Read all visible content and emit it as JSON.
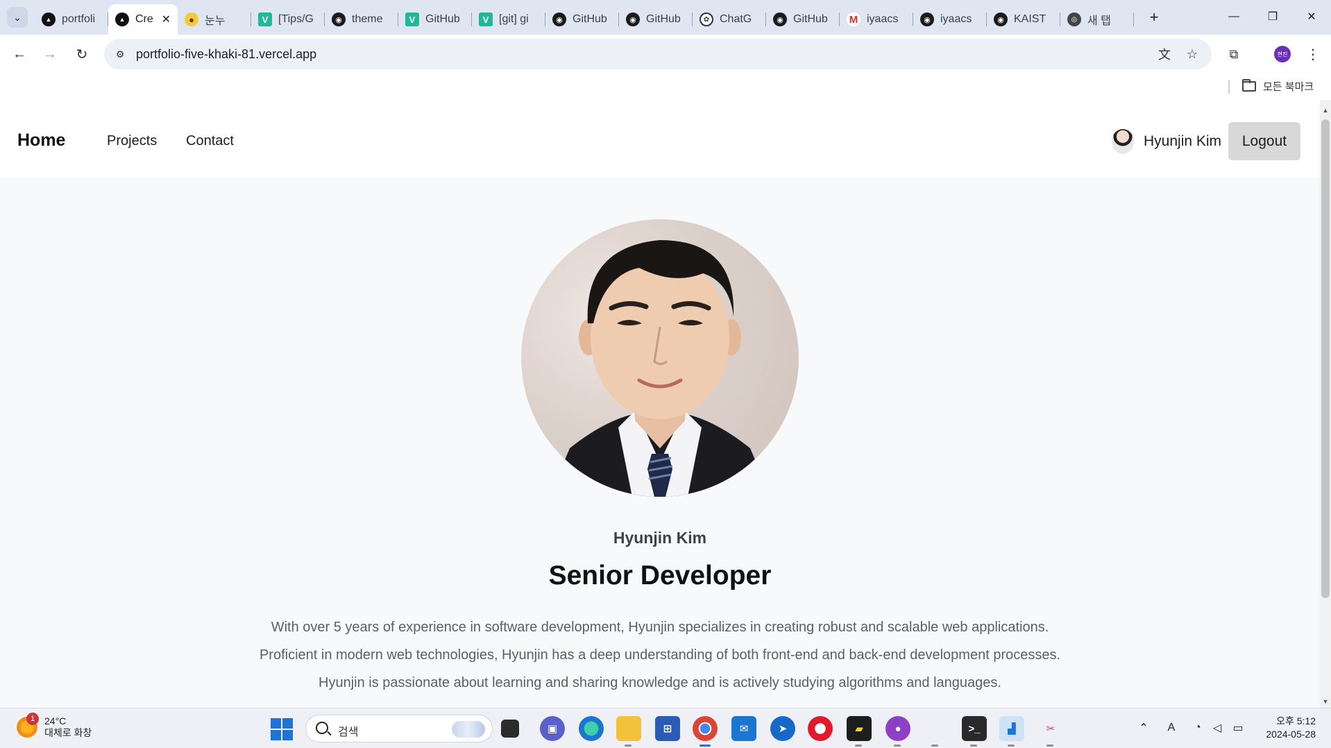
{
  "browser": {
    "tabs": [
      {
        "label": "portfoli",
        "icon": "vercel-icon",
        "active": false
      },
      {
        "label": "Cre",
        "icon": "vercel-icon",
        "active": true
      },
      {
        "label": "눈누",
        "icon": "duck-icon",
        "active": false
      },
      {
        "label": "[Tips/G",
        "icon": "velog-icon",
        "active": false
      },
      {
        "label": "theme",
        "icon": "github-icon",
        "active": false
      },
      {
        "label": "GitHub",
        "icon": "velog-icon",
        "active": false
      },
      {
        "label": "[git] gi",
        "icon": "velog-icon",
        "active": false
      },
      {
        "label": "GitHub",
        "icon": "github-icon",
        "active": false
      },
      {
        "label": "GitHub",
        "icon": "github-icon",
        "active": false
      },
      {
        "label": "ChatG",
        "icon": "chatgpt-icon",
        "active": false
      },
      {
        "label": "GitHub",
        "icon": "github-icon",
        "active": false
      },
      {
        "label": "iyaacs",
        "icon": "gmail-icon",
        "active": false
      },
      {
        "label": "iyaacs",
        "icon": "github-icon",
        "active": false
      },
      {
        "label": "KAIST",
        "icon": "github-icon",
        "active": false
      },
      {
        "label": "새 탭",
        "icon": "chrome-icon",
        "active": false
      }
    ],
    "url": "portfolio-five-khaki-81.vercel.app",
    "profile_initials": "현진",
    "bookmarks_folder": "모든 북마크"
  },
  "site": {
    "nav": {
      "home": "Home",
      "projects": "Projects",
      "contact": "Contact",
      "user_name": "Hyunjin Kim",
      "logout": "Logout"
    },
    "hero": {
      "name": "Hyunjin Kim",
      "title": "Senior Developer",
      "bio": [
        "With over 5 years of experience in software development, Hyunjin specializes in creating robust and scalable web applications.",
        "Proficient in modern web technologies, Hyunjin has a deep understanding of both front-end and back-end development processes.",
        "Hyunjin is passionate about learning and sharing knowledge and is actively studying algorithms and languages."
      ]
    }
  },
  "taskbar": {
    "weather_temp": "24°C",
    "weather_desc": "대체로 화창",
    "weather_badge": "1",
    "search_placeholder": "검색",
    "clock_time": "오후 5:12",
    "clock_date": "2024-05-28"
  },
  "colors": {
    "tabstrip": "#dfe5f1",
    "page_bg": "#f8f9fb",
    "logout_bg": "#d8d8d8",
    "profile": "#6a2fb3",
    "windows_blue": "#1e74d6"
  }
}
